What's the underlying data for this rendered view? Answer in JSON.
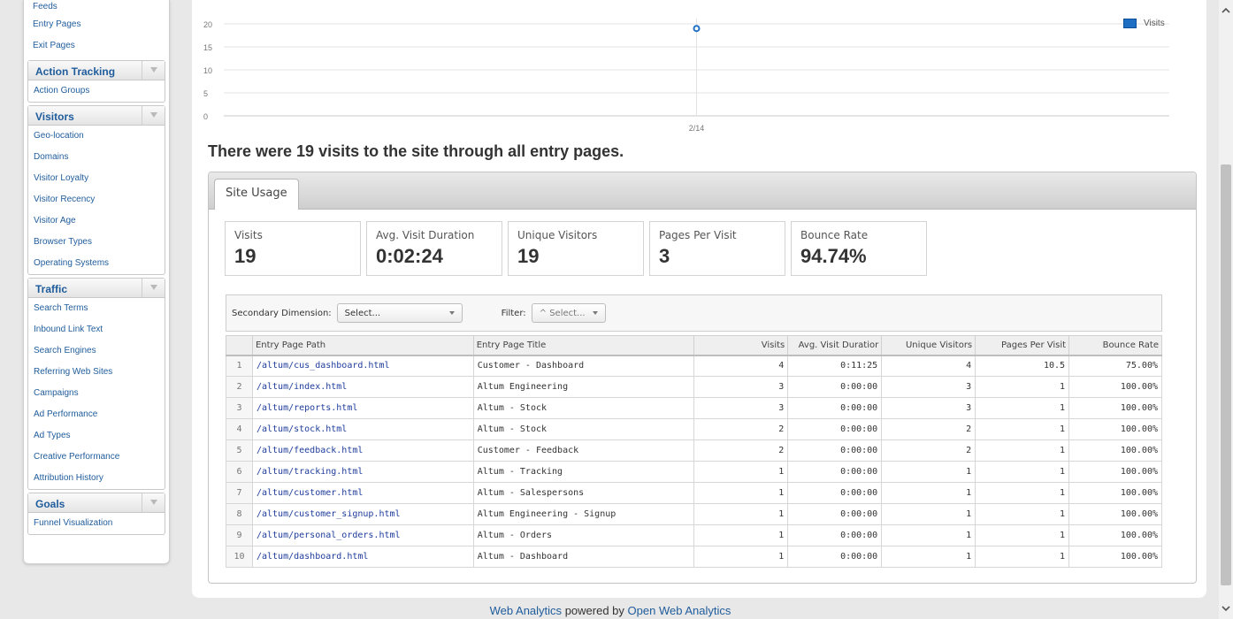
{
  "sidebar": {
    "top_links": [
      "Feeds",
      "Entry Pages",
      "Exit Pages"
    ],
    "groups": [
      {
        "title": "Action Tracking",
        "items": [
          "Action Groups"
        ]
      },
      {
        "title": "Visitors",
        "items": [
          "Geo-location",
          "Domains",
          "Visitor Loyalty",
          "Visitor Recency",
          "Visitor Age",
          "Browser Types",
          "Operating Systems"
        ]
      },
      {
        "title": "Traffic",
        "items": [
          "Search Terms",
          "Inbound Link Text",
          "Search Engines",
          "Referring Web Sites",
          "Campaigns",
          "Ad Performance",
          "Ad Types",
          "Creative Performance",
          "Attribution History"
        ]
      },
      {
        "title": "Goals",
        "items": [
          "Funnel Visualization"
        ]
      }
    ]
  },
  "chart_data": {
    "type": "line",
    "x": [
      "2/14"
    ],
    "series": [
      {
        "name": "Visits",
        "values": [
          19
        ]
      }
    ],
    "y_ticks": [
      0,
      5,
      10,
      15,
      20
    ],
    "ylim": [
      0,
      20
    ],
    "legend_position": "top-right",
    "grid": true,
    "color": "#1e6fc4"
  },
  "headline": "There were 19 visits to the site through all entry pages.",
  "usage": {
    "tab": "Site Usage",
    "kpis": [
      {
        "label": "Visits",
        "value": "19"
      },
      {
        "label": "Avg. Visit Duration",
        "value": "0:02:24"
      },
      {
        "label": "Unique Visitors",
        "value": "19"
      },
      {
        "label": "Pages Per Visit",
        "value": "3"
      },
      {
        "label": "Bounce Rate",
        "value": "94.74%"
      }
    ],
    "secondary_dimension_label": "Secondary Dimension:",
    "secondary_dimension_value": "Select...",
    "filter_label": "Filter:",
    "filter_value": "Select...",
    "columns": [
      "Entry Page Path",
      "Entry Page Title",
      "Visits",
      "Avg. Visit Duratior",
      "Unique Visitors",
      "Pages Per Visit",
      "Bounce Rate"
    ],
    "rows": [
      [
        "1",
        "/altum/cus_dashboard.html",
        "Customer - Dashboard",
        "4",
        "0:11:25",
        "4",
        "10.5",
        "75.00%"
      ],
      [
        "2",
        "/altum/index.html",
        "Altum Engineering",
        "3",
        "0:00:00",
        "3",
        "1",
        "100.00%"
      ],
      [
        "3",
        "/altum/reports.html",
        "Altum - Stock",
        "3",
        "0:00:00",
        "3",
        "1",
        "100.00%"
      ],
      [
        "4",
        "/altum/stock.html",
        "Altum - Stock",
        "2",
        "0:00:00",
        "2",
        "1",
        "100.00%"
      ],
      [
        "5",
        "/altum/feedback.html",
        "Customer - Feedback",
        "2",
        "0:00:00",
        "2",
        "1",
        "100.00%"
      ],
      [
        "6",
        "/altum/tracking.html",
        "Altum - Tracking",
        "1",
        "0:00:00",
        "1",
        "1",
        "100.00%"
      ],
      [
        "7",
        "/altum/customer.html",
        "Altum - Salespersons",
        "1",
        "0:00:00",
        "1",
        "1",
        "100.00%"
      ],
      [
        "8",
        "/altum/customer_signup.html",
        "Altum Engineering - Signup",
        "1",
        "0:00:00",
        "1",
        "1",
        "100.00%"
      ],
      [
        "9",
        "/altum/personal_orders.html",
        "Altum - Orders",
        "1",
        "0:00:00",
        "1",
        "1",
        "100.00%"
      ],
      [
        "10",
        "/altum/dashboard.html",
        "Altum - Dashboard",
        "1",
        "0:00:00",
        "1",
        "1",
        "100.00%"
      ]
    ]
  },
  "footer": {
    "link1": "Web Analytics",
    "middle": "powered by",
    "link2": "Open Web Analytics"
  },
  "icons": {
    "scroll_up": "chevron-up-icon",
    "scroll_down": "chevron-down-icon",
    "collapse": "triangle-down-icon"
  }
}
